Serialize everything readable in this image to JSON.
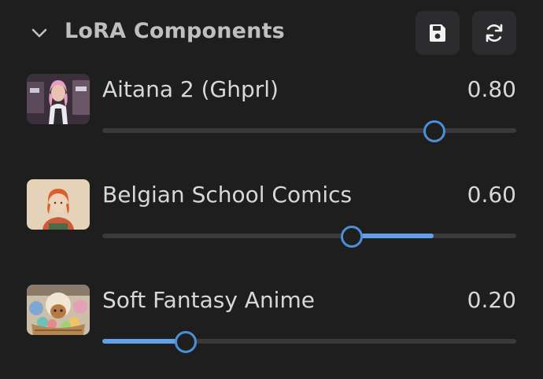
{
  "panel": {
    "title": "LoRA Components",
    "icons": {
      "collapse": "chevron-down-icon",
      "save": "save-icon",
      "refresh": "refresh-icon"
    }
  },
  "colors": {
    "background": "#1e1e1f",
    "accent": "#4b8fd9",
    "fill": "#62a0e8",
    "track": "#3a3a3d"
  },
  "loras": [
    {
      "name": "Aitana 2 (Ghprl)",
      "value": "0.80",
      "default": "0.80"
    },
    {
      "name": "Belgian School Comics",
      "value": "0.60",
      "default": "0.80"
    },
    {
      "name": "Soft Fantasy Anime",
      "value": "0.20",
      "default": "0.00"
    }
  ]
}
